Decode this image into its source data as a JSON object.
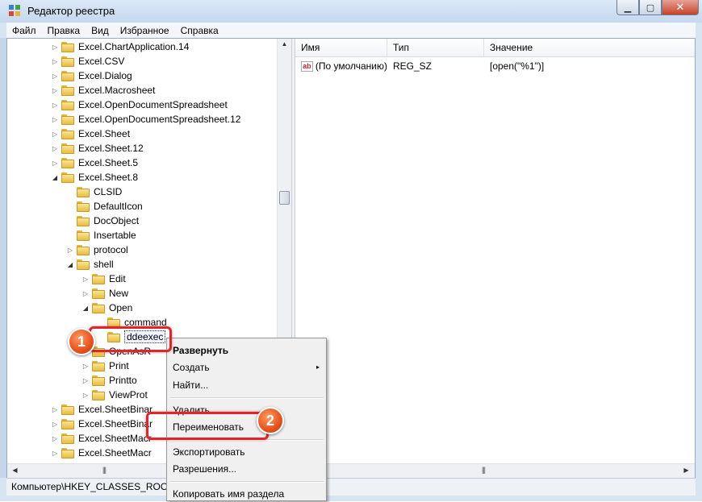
{
  "window": {
    "title": "Редактор реестра",
    "icon": "regedit-icon"
  },
  "caption_buttons": [
    "minimize-button",
    "maximize-button",
    "close-button"
  ],
  "menubar": [
    "Файл",
    "Правка",
    "Вид",
    "Избранное",
    "Справка"
  ],
  "tree": [
    {
      "label": "Excel.ChartApplication.14",
      "expander": "▷",
      "level": 1
    },
    {
      "label": "Excel.CSV",
      "expander": "▷",
      "level": 1
    },
    {
      "label": "Excel.Dialog",
      "expander": "▷",
      "level": 1
    },
    {
      "label": "Excel.Macrosheet",
      "expander": "▷",
      "level": 1
    },
    {
      "label": "Excel.OpenDocumentSpreadsheet",
      "expander": "▷",
      "level": 1
    },
    {
      "label": "Excel.OpenDocumentSpreadsheet.12",
      "expander": "▷",
      "level": 1
    },
    {
      "label": "Excel.Sheet",
      "expander": "▷",
      "level": 1
    },
    {
      "label": "Excel.Sheet.12",
      "expander": "▷",
      "level": 1
    },
    {
      "label": "Excel.Sheet.5",
      "expander": "▷",
      "level": 1
    },
    {
      "label": "Excel.Sheet.8",
      "expander": "◢",
      "level": 1
    },
    {
      "label": "CLSID",
      "expander": "",
      "level": 2
    },
    {
      "label": "DefaultIcon",
      "expander": "",
      "level": 2
    },
    {
      "label": "DocObject",
      "expander": "",
      "level": 2
    },
    {
      "label": "Insertable",
      "expander": "",
      "level": 2
    },
    {
      "label": "protocol",
      "expander": "▷",
      "level": 2
    },
    {
      "label": "shell",
      "expander": "◢",
      "level": 2
    },
    {
      "label": "Edit",
      "expander": "▷",
      "level": 3
    },
    {
      "label": "New",
      "expander": "▷",
      "level": 3
    },
    {
      "label": "Open",
      "expander": "◢",
      "level": 3
    },
    {
      "label": "command",
      "expander": "",
      "level": 4
    },
    {
      "label": "ddeexec",
      "expander": "",
      "level": 4,
      "selected": true
    },
    {
      "label": "OpenAsR",
      "expander": "▷",
      "level": 3
    },
    {
      "label": "Print",
      "expander": "▷",
      "level": 3
    },
    {
      "label": "Printto",
      "expander": "▷",
      "level": 3
    },
    {
      "label": "ViewProt",
      "expander": "▷",
      "level": 3
    },
    {
      "label": "Excel.SheetBinar",
      "expander": "▷",
      "level": 1
    },
    {
      "label": "Excel.SheetBinar",
      "expander": "▷",
      "level": 1
    },
    {
      "label": "Excel.SheetMacr",
      "expander": "▷",
      "level": 1
    },
    {
      "label": "Excel.SheetMacr",
      "expander": "▷",
      "level": 1
    }
  ],
  "list": {
    "columns": [
      "Имя",
      "Тип",
      "Значение"
    ],
    "rows": [
      {
        "name": "(По умолчанию)",
        "type": "REG_SZ",
        "value": "[open(\"%1\")]",
        "icon": "ab"
      }
    ]
  },
  "status_bar": "Компьютер\\HKEY_CLASSES_ROOT\\Excel.Sheet.8\\shell\\Open\\ddeexec",
  "context_menu": [
    {
      "label": "Развернуть",
      "bold": true
    },
    {
      "label": "Создать",
      "submenu": "▸"
    },
    {
      "label": "Найти..."
    },
    {
      "label": "Удалить"
    },
    {
      "label": "Переименовать"
    },
    {
      "label": "Экспортировать"
    },
    {
      "label": "Разрешения..."
    },
    {
      "label": "Копировать имя раздела"
    }
  ],
  "annotations": [
    {
      "number": "1",
      "target": "ddeexec"
    },
    {
      "number": "2",
      "target": "Переименовать"
    }
  ],
  "colors": {
    "highlight": "#e3242b",
    "badge": "#e6521c",
    "title_bg": "#dbe8f6"
  }
}
